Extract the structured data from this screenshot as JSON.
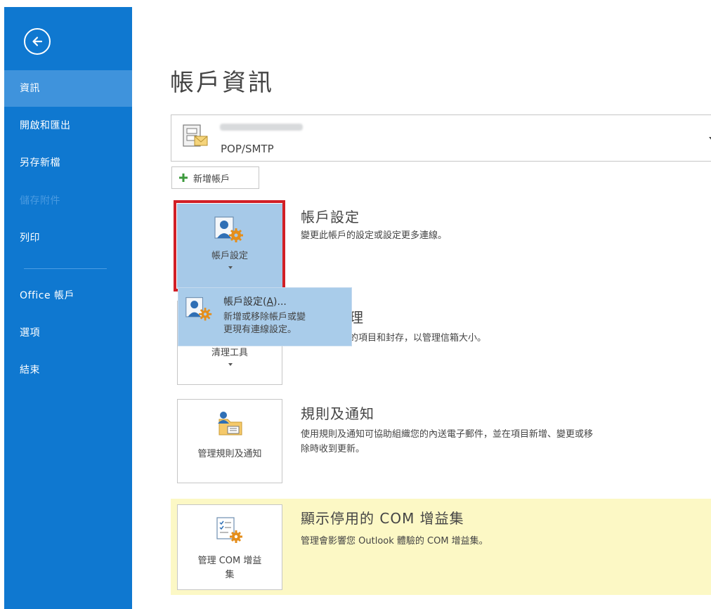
{
  "sidebar": {
    "items": [
      {
        "label": "資訊",
        "active": true
      },
      {
        "label": "開啟和匯出"
      },
      {
        "label": "另存新檔"
      },
      {
        "label": "儲存附件",
        "disabled": true
      },
      {
        "label": "列印"
      },
      {
        "label": "Office 帳戶"
      },
      {
        "label": "選項"
      },
      {
        "label": "結束"
      }
    ],
    "back_icon": "back-arrow-circle-icon"
  },
  "page_title": "帳戶資訊",
  "account": {
    "type": "POP/SMTP"
  },
  "add_account_label": "新增帳戶",
  "sections": {
    "account_settings": {
      "tile_label": "帳戶設定",
      "title": "帳戶設定",
      "desc": "變更此帳戶的設定或設定更多連線。"
    },
    "cleanup": {
      "tile_label": "清理工具",
      "title_partial": "理",
      "desc_partial": "的項目和封存，以管理信箱大小。"
    },
    "rules": {
      "tile_label": "管理規則及通知",
      "title": "規則及通知",
      "desc_line1": "使用規則及通知可協助組織您的內送電子郵件，並在項目新增、變更或移",
      "desc_line2": "除時收到更新。"
    },
    "com": {
      "tile_label_line1": "管理 COM 增益",
      "tile_label_line2": "集",
      "title": "顯示停用的 COM 增益集",
      "desc": "管理會影響您 Outlook 體驗的 COM 增益集。"
    }
  },
  "popup": {
    "title_prefix": "帳戶設定(",
    "title_accel": "A",
    "title_suffix": ")...",
    "desc_line1": "新增或移除帳戶或變",
    "desc_line2": "更現有連線設定。"
  },
  "colors": {
    "sidebar_bg": "#0f78d0",
    "sidebar_active": "#3f93dc",
    "highlight_red": "#d21f26",
    "tile_selected": "#a6c9e8",
    "yellow_band": "#fcf8c5"
  }
}
